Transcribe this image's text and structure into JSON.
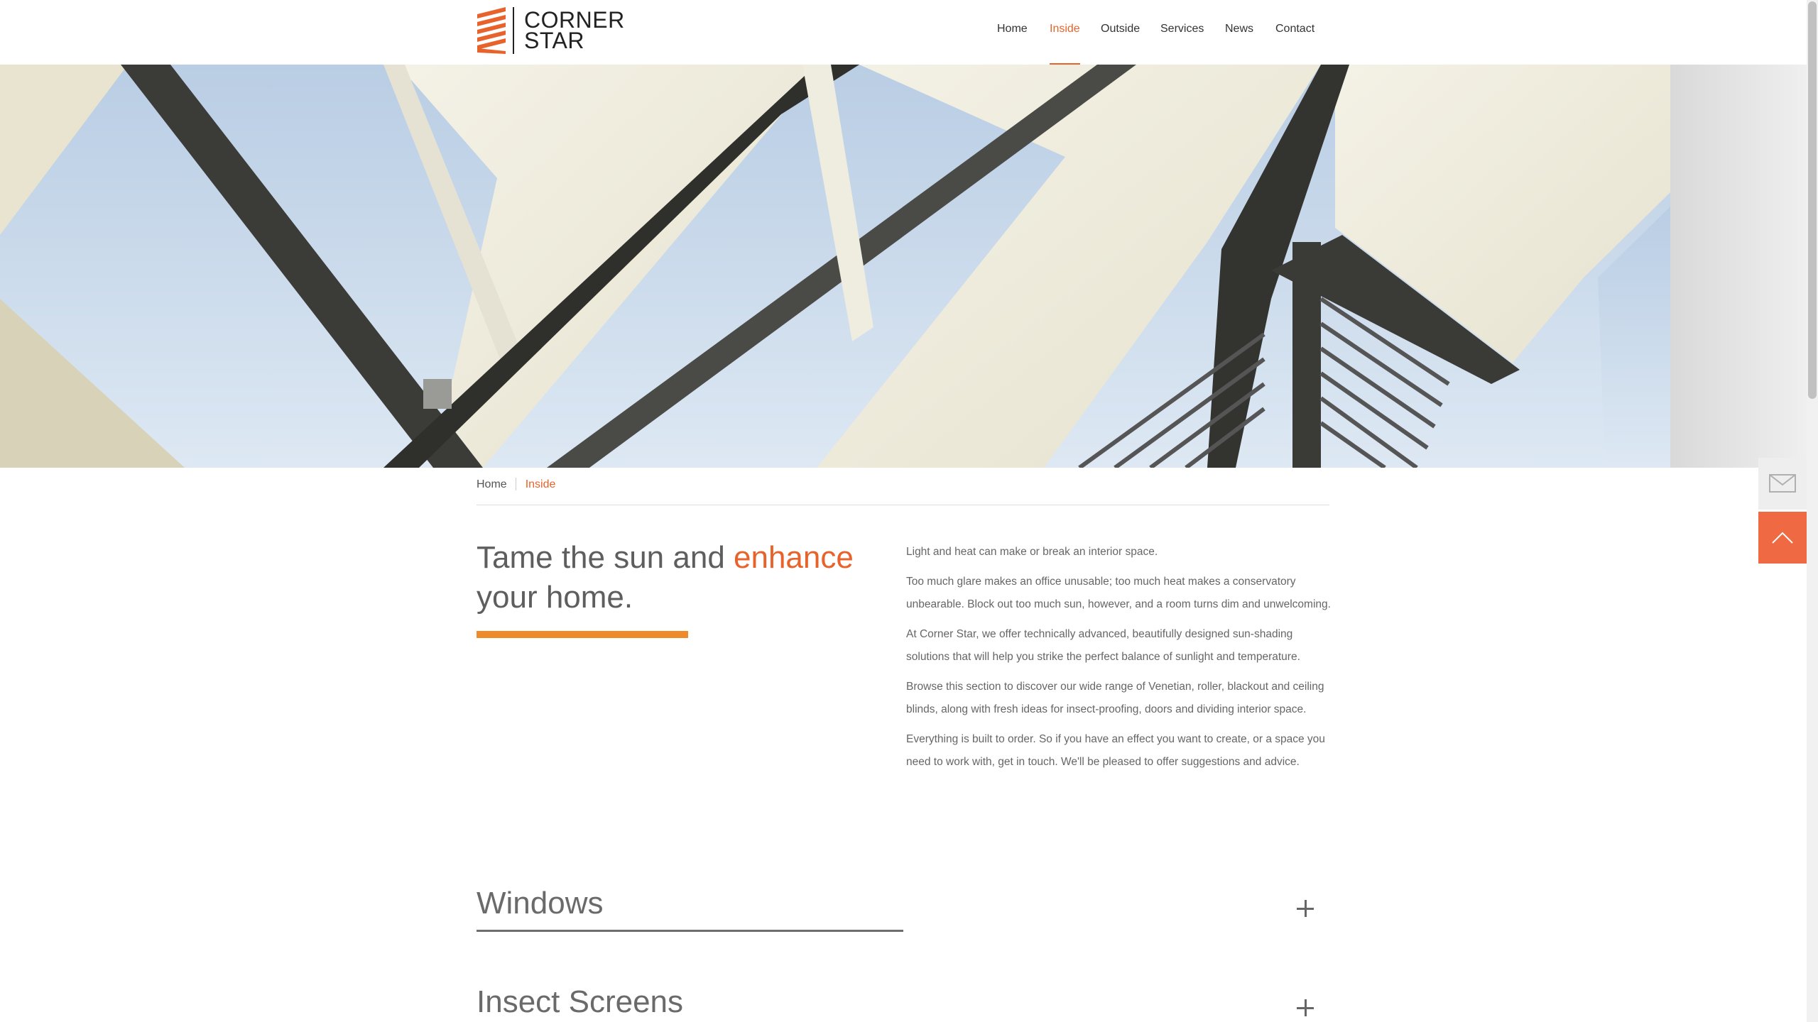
{
  "brand": {
    "name_line1": "CORNER",
    "name_line2": "STAR",
    "accent_color": "#e8632b",
    "icon": "stacked-bars-logo-icon"
  },
  "nav": {
    "items": [
      {
        "label": "Home",
        "active": false
      },
      {
        "label": "Inside",
        "active": true
      },
      {
        "label": "Outside",
        "active": false
      },
      {
        "label": "Services",
        "active": false
      },
      {
        "label": "News",
        "active": false
      },
      {
        "label": "Contact",
        "active": false
      }
    ]
  },
  "hero": {
    "icon": "conservatory-roof-blinds-image"
  },
  "side_buttons": {
    "mail_icon": "envelope-icon",
    "top_icon": "chevron-up-icon",
    "top_color": "#ef6a43"
  },
  "breadcrumb": {
    "items": [
      "Home",
      "Inside"
    ]
  },
  "intro": {
    "headline_part1": "Tame the sun and ",
    "headline_accent": "enhance",
    "headline_part2": "your home.",
    "headline_bar_color": "#ef8a2a",
    "paragraphs": [
      "Light and heat can make or break an interior space.",
      "Too much glare makes an office unusable; too much heat makes a conservatory unbearable. Block out too much sun, however, and a room turns dim and unwelcoming.",
      "At Corner Star, we offer technically advanced, beautifully designed sun-shading solutions that will help you strike the perfect balance of sunlight and temperature.",
      "Browse this section to discover our wide range of Venetian, roller, blackout and ceiling blinds, along with fresh ideas for insect-proofing, doors and dividing interior space.",
      "Everything is built to order. So if you have an effect you want to create, or a space you need to work with, get in touch. We'll be pleased to offer suggestions and advice."
    ]
  },
  "sections": [
    {
      "title": "Windows",
      "expand_icon": "plus-icon"
    },
    {
      "title": "Insect Screens",
      "expand_icon": "plus-icon"
    }
  ]
}
